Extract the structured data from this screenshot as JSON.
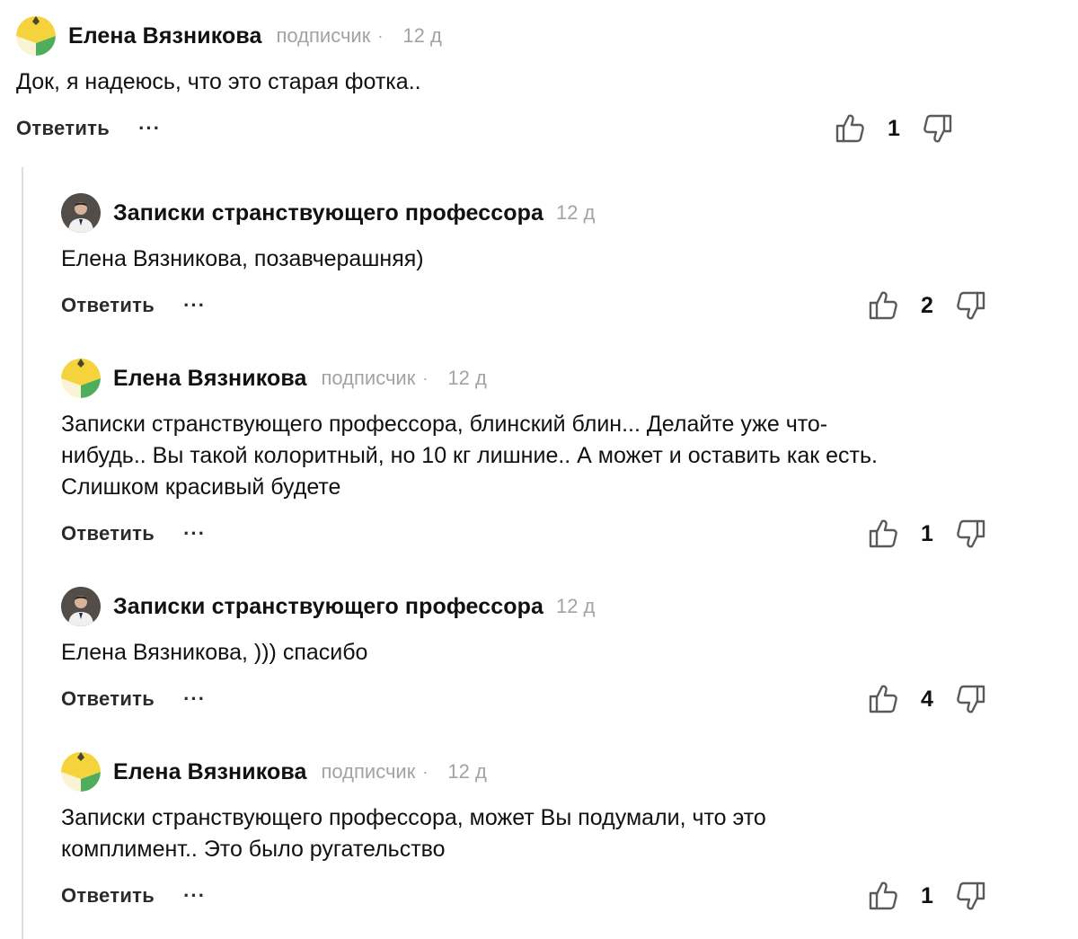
{
  "comments": [
    {
      "author": "Елена Вязникова",
      "badge": "подписчик",
      "dot": "·",
      "time": "12 д",
      "text": "Док, я надеюсь, что это старая фотка..",
      "reply_label": "Ответить",
      "more_label": "···",
      "likes": "1",
      "avatar": "yellow-green-avatar"
    },
    {
      "author": "Записки странствующего профессора",
      "time": "12 д",
      "text": "Елена Вязникова, позавчерашняя)",
      "reply_label": "Ответить",
      "more_label": "···",
      "likes": "2",
      "avatar": "professor-photo-avatar"
    },
    {
      "author": "Елена Вязникова",
      "badge": "подписчик",
      "dot": "·",
      "time": "12 д",
      "text_lines": [
        "Записки странствующего профессора, блинский блин... Делайте уже что-",
        "нибудь.. Вы такой колоритный, но 10 кг лишние.. А может и оставить как есть.",
        "Слишком красивый будете"
      ],
      "reply_label": "Ответить",
      "more_label": "···",
      "likes": "1",
      "avatar": "yellow-green-avatar"
    },
    {
      "author": "Записки странствующего профессора",
      "time": "12 д",
      "text": "Елена Вязникова, ))) спасибо",
      "reply_label": "Ответить",
      "more_label": "···",
      "likes": "4",
      "avatar": "professor-photo-avatar"
    },
    {
      "author": "Елена Вязникова",
      "badge": "подписчик",
      "dot": "·",
      "time": "12 д",
      "text_lines": [
        "Записки странствующего профессора, может Вы подумали, что это",
        "комплимент.. Это было ругательство"
      ],
      "reply_label": "Ответить",
      "more_label": "···",
      "likes": "1",
      "avatar": "yellow-green-avatar"
    }
  ],
  "colors": {
    "avatar_yellow": "#f5d33c",
    "avatar_green": "#4fae5e",
    "avatar_cream": "#fbf3d6",
    "meta_gray": "#a3a3a3",
    "thread_line": "#dedede"
  }
}
